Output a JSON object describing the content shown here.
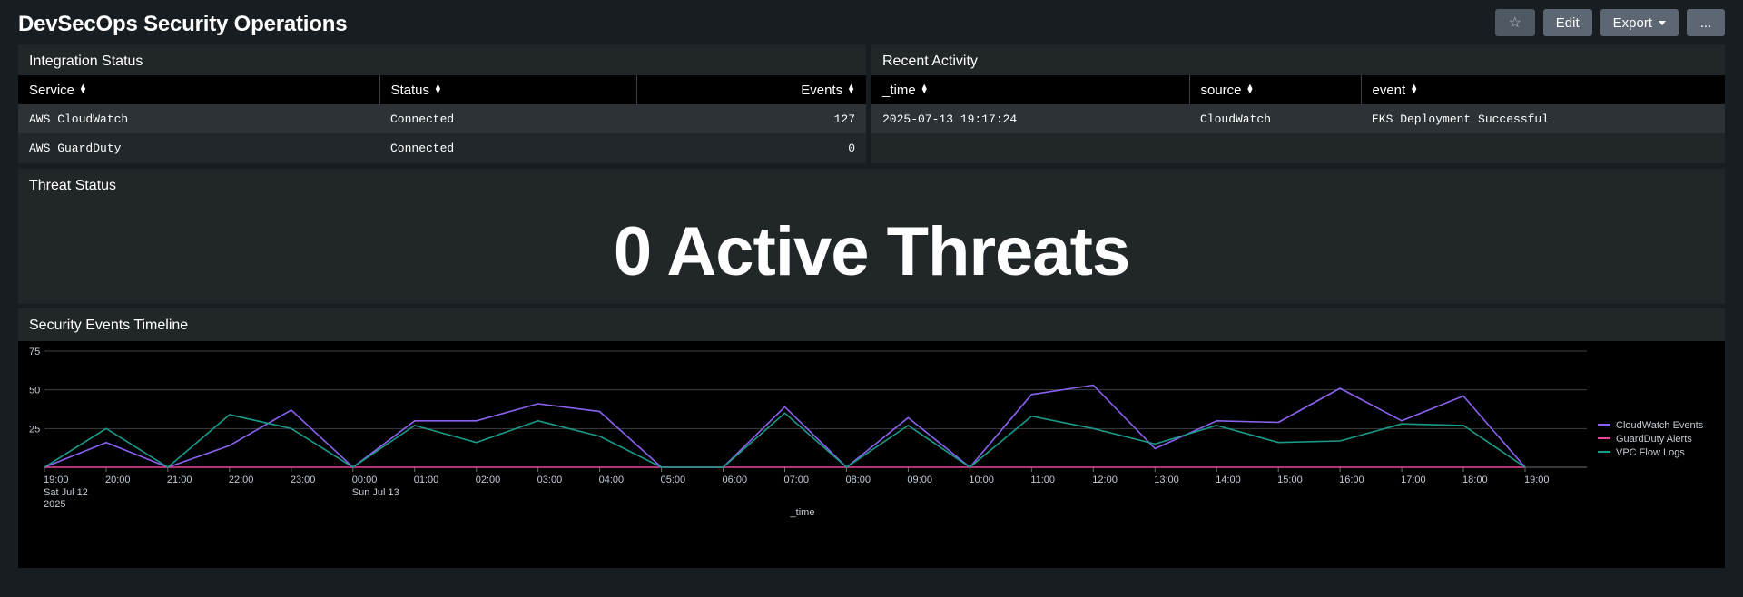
{
  "header": {
    "title": "DevSecOps Security Operations",
    "star_icon": "☆",
    "edit_label": "Edit",
    "export_label": "Export",
    "more_label": "..."
  },
  "integration_status": {
    "title": "Integration Status",
    "columns": [
      "Service",
      "Status",
      "Events"
    ],
    "rows": [
      [
        "AWS CloudWatch",
        "Connected",
        "127"
      ],
      [
        "AWS GuardDuty",
        "Connected",
        "0"
      ]
    ]
  },
  "recent_activity": {
    "title": "Recent Activity",
    "columns": [
      "_time",
      "source",
      "event"
    ],
    "rows": [
      [
        "2025-07-13 19:17:24",
        "CloudWatch",
        "EKS Deployment Successful"
      ]
    ]
  },
  "threat_status": {
    "title": "Threat Status",
    "value": "0 Active Threats"
  },
  "timeline": {
    "title": "Security Events Timeline"
  },
  "chart_data": {
    "type": "line",
    "xlabel": "_time",
    "ylabel": "",
    "ylim": [
      0,
      75
    ],
    "yticks": [
      25,
      50,
      75
    ],
    "grid": true,
    "legend_position": "right",
    "x": [
      "19:00",
      "20:00",
      "21:00",
      "22:00",
      "23:00",
      "00:00",
      "01:00",
      "02:00",
      "03:00",
      "04:00",
      "05:00",
      "06:00",
      "07:00",
      "08:00",
      "09:00",
      "10:00",
      "11:00",
      "12:00",
      "13:00",
      "14:00",
      "15:00",
      "16:00",
      "17:00",
      "18:00",
      "19:00"
    ],
    "x_sublabels": {
      "0": [
        "Sat Jul 12",
        "2025"
      ],
      "5": [
        "Sun Jul 13"
      ]
    },
    "series": [
      {
        "name": "CloudWatch Events",
        "color": "#8b62f0",
        "values": [
          0,
          16,
          0,
          14,
          37,
          0,
          30,
          30,
          41,
          36,
          0,
          0,
          39,
          0,
          32,
          0,
          47,
          53,
          12,
          30,
          29,
          51,
          30,
          46,
          0
        ]
      },
      {
        "name": "GuardDuty Alerts",
        "color": "#e8459c",
        "values": [
          0,
          0,
          0,
          0,
          0,
          0,
          0,
          0,
          0,
          0,
          0,
          0,
          0,
          0,
          0,
          0,
          0,
          0,
          0,
          0,
          0,
          0,
          0,
          0,
          0
        ]
      },
      {
        "name": "VPC Flow Logs",
        "color": "#1a9a8a",
        "values": [
          0,
          25,
          0,
          34,
          25,
          0,
          27,
          16,
          30,
          20,
          0,
          0,
          35,
          0,
          27,
          0,
          33,
          25,
          15,
          27,
          16,
          17,
          28,
          27,
          0
        ]
      }
    ]
  }
}
